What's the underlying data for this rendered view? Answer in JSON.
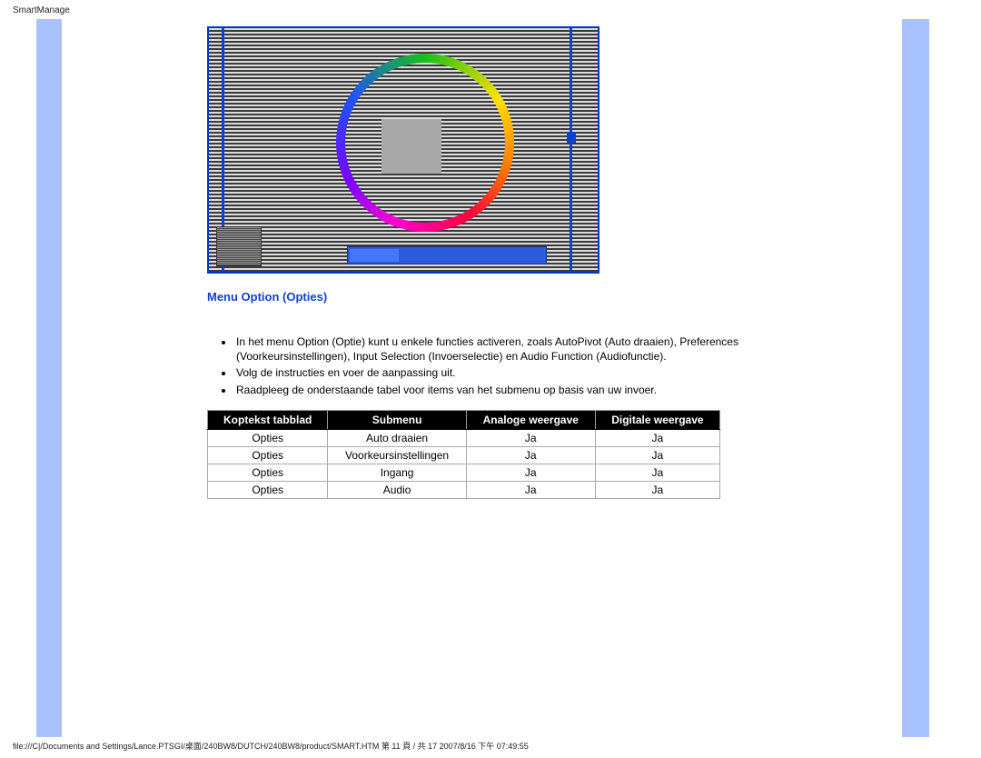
{
  "header": {
    "title": "SmartManage"
  },
  "section": {
    "title": "Menu Option (Opties)"
  },
  "bullets": [
    "In het menu Option (Optie) kunt u enkele functies activeren, zoals AutoPivot (Auto draaien), Preferences (Voorkeursinstellingen), Input Selection (Invoerselectie) en Audio Function (Audiofunctie).",
    "Volg de instructies en voer de aanpassing uit.",
    "Raadpleeg de onderstaande tabel voor items van het submenu op basis van uw invoer."
  ],
  "table": {
    "headers": [
      "Koptekst tabblad",
      "Submenu",
      "Analoge weergave",
      "Digitale weergave"
    ],
    "rows": [
      [
        "Opties",
        "Auto draaien",
        "Ja",
        "Ja"
      ],
      [
        "Opties",
        "Voorkeursinstellingen",
        "Ja",
        "Ja"
      ],
      [
        "Opties",
        "Ingang",
        "Ja",
        "Ja"
      ],
      [
        "Opties",
        "Audio",
        "Ja",
        "Ja"
      ]
    ]
  },
  "footer": {
    "text": "file:///C|/Documents and Settings/Lance.PTSGI/桌面/240BW8/DUTCH/240BW8/product/SMART.HTM 第 11 頁 / 共 17 2007/8/16 下午 07:49:55"
  }
}
